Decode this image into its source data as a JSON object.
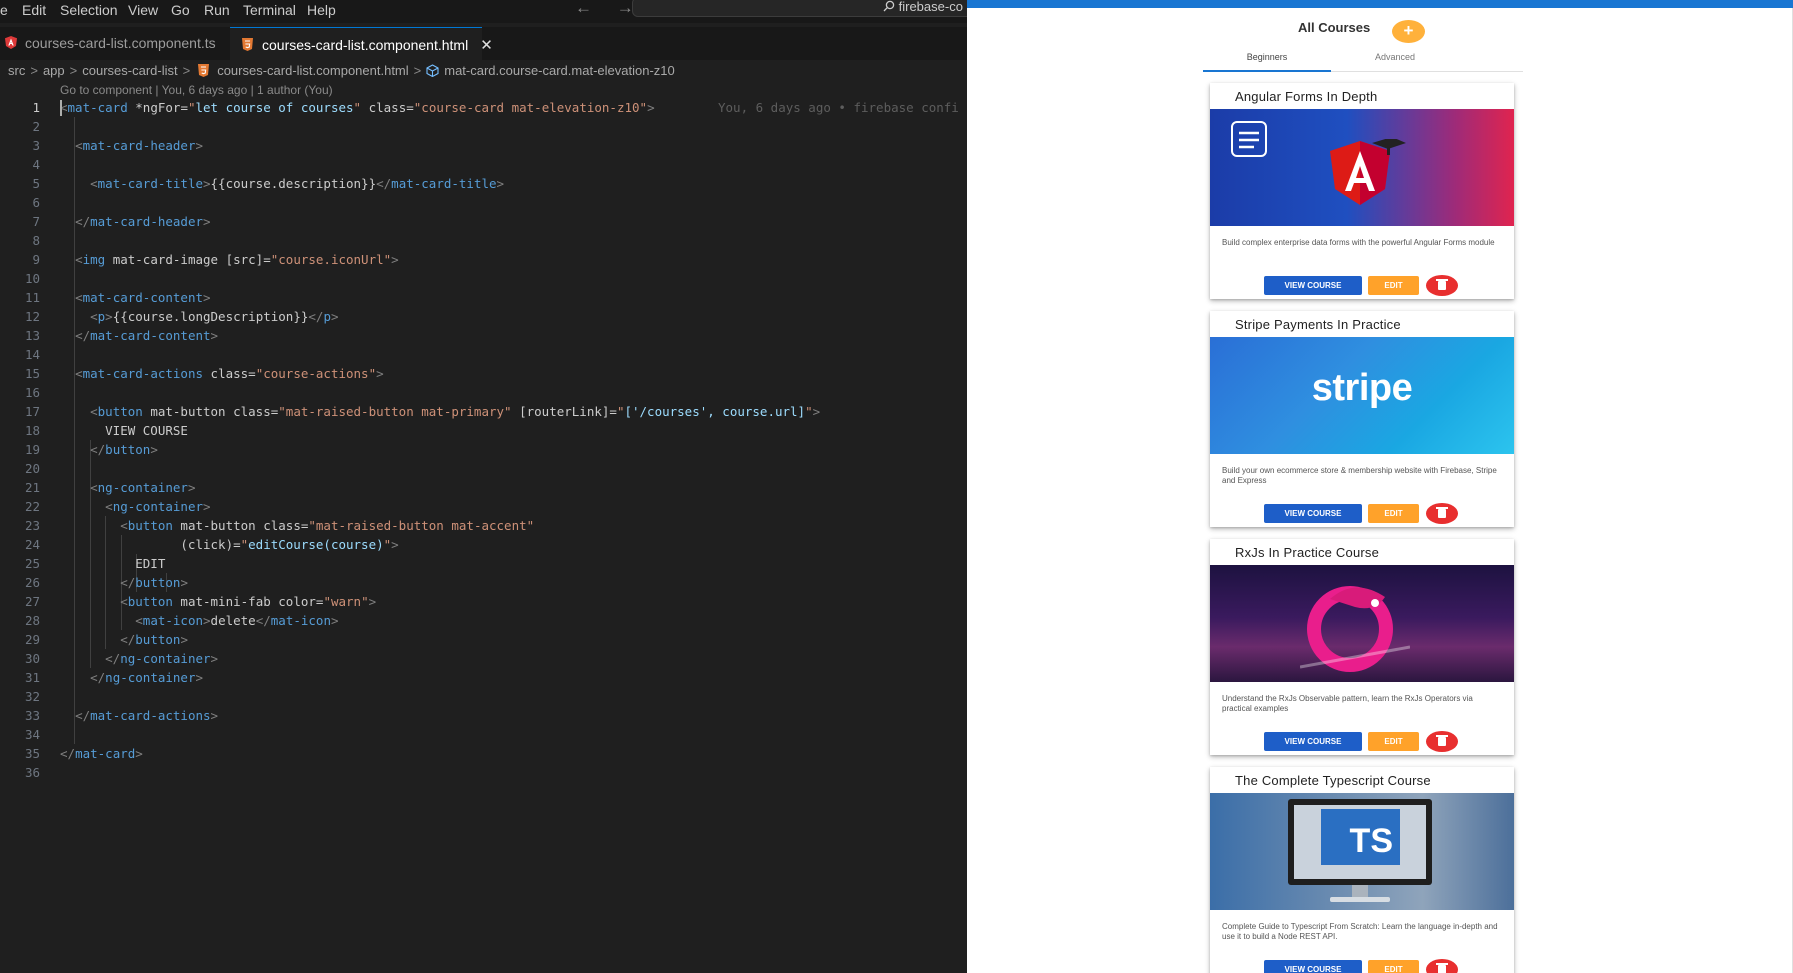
{
  "menu": {
    "items": [
      "e",
      "Edit",
      "Selection",
      "View",
      "Go",
      "Run",
      "Terminal",
      "Help"
    ],
    "nav_arrows": "← →",
    "search_text": "firebase-co"
  },
  "tabs": [
    {
      "label": "courses-card-list.component.ts",
      "active": false
    },
    {
      "label": "courses-card-list.component.html",
      "active": true,
      "close": "✕"
    }
  ],
  "breadcrumb": [
    "src",
    "app",
    "courses-card-list",
    "courses-card-list.component.html",
    "mat-card.course-card.mat-elevation-z10"
  ],
  "breadcrumb_sep": ">",
  "codelens": "Go to component | You, 6 days ago | 1 author (You)",
  "blame": "You, 6 days ago • firebase confi",
  "code": {
    "line_numbers": [
      "1",
      "2",
      "3",
      "4",
      "5",
      "6",
      "7",
      "8",
      "9",
      "10",
      "11",
      "12",
      "13",
      "14",
      "15",
      "16",
      "17",
      "18",
      "19",
      "20",
      "21",
      "22",
      "23",
      "24",
      "25",
      "26",
      "27",
      "28",
      "29",
      "30",
      "31",
      "32",
      "33",
      "34",
      "35",
      "36"
    ],
    "lines": [
      "<mat-card *ngFor=\"let course of courses\" class=\"course-card mat-elevation-z10\">",
      "",
      "  <mat-card-header>",
      "",
      "    <mat-card-title>{{course.description}}</mat-card-title>",
      "",
      "  </mat-card-header>",
      "",
      "  <img mat-card-image [src]=\"course.iconUrl\">",
      "",
      "  <mat-card-content>",
      "    <p>{{course.longDescription}}</p>",
      "  </mat-card-content>",
      "",
      "  <mat-card-actions class=\"course-actions\">",
      "",
      "    <button mat-button class=\"mat-raised-button mat-primary\" [routerLink]=\"['/courses', course.url]\">",
      "      VIEW COURSE",
      "    </button>",
      "",
      "    <ng-container>",
      "      <ng-container>",
      "        <button mat-button class=\"mat-raised-button mat-accent\"",
      "                (click)=\"editCourse(course)\">",
      "          EDIT",
      "        </button>",
      "        <button mat-mini-fab color=\"warn\">",
      "          <mat-icon>delete</mat-icon>",
      "        </button>",
      "      </ng-container>",
      "    </ng-container>",
      "",
      "  </mat-card-actions>",
      "",
      "</mat-card>",
      ""
    ]
  },
  "app": {
    "title": "All Courses",
    "add_symbol": "+",
    "tabs": [
      "Beginners",
      "Advanced"
    ],
    "view_label": "VIEW COURSE",
    "edit_label": "EDIT",
    "cards": [
      {
        "title": "Angular Forms In Depth",
        "description": "Build complex enterprise data forms with the powerful Angular Forms module",
        "image": "angular-logo-icon"
      },
      {
        "title": "Stripe Payments In Practice",
        "description": "Build your own ecommerce store & membership website with Firebase, Stripe and Express",
        "image": "stripe-logo-icon",
        "logo_text": "stripe"
      },
      {
        "title": "RxJs In Practice Course",
        "description": "Understand the RxJs Observable pattern, learn the RxJs Operators via practical examples",
        "image": "rxjs-logo-icon"
      },
      {
        "title": "The Complete Typescript Course",
        "description": "Complete Guide to Typescript From Scratch: Learn the language in-depth and use it to build a Node REST API.",
        "image": "typescript-monitor-icon",
        "logo_text": "TS"
      }
    ]
  },
  "colors": {
    "editor_bg": "#1f1f1f",
    "accent_blue": "#1976d2",
    "view_button": "#1e5ec8",
    "edit_button": "#ffa22a",
    "delete_button": "#e82f2f",
    "fab": "#ffb13b"
  }
}
